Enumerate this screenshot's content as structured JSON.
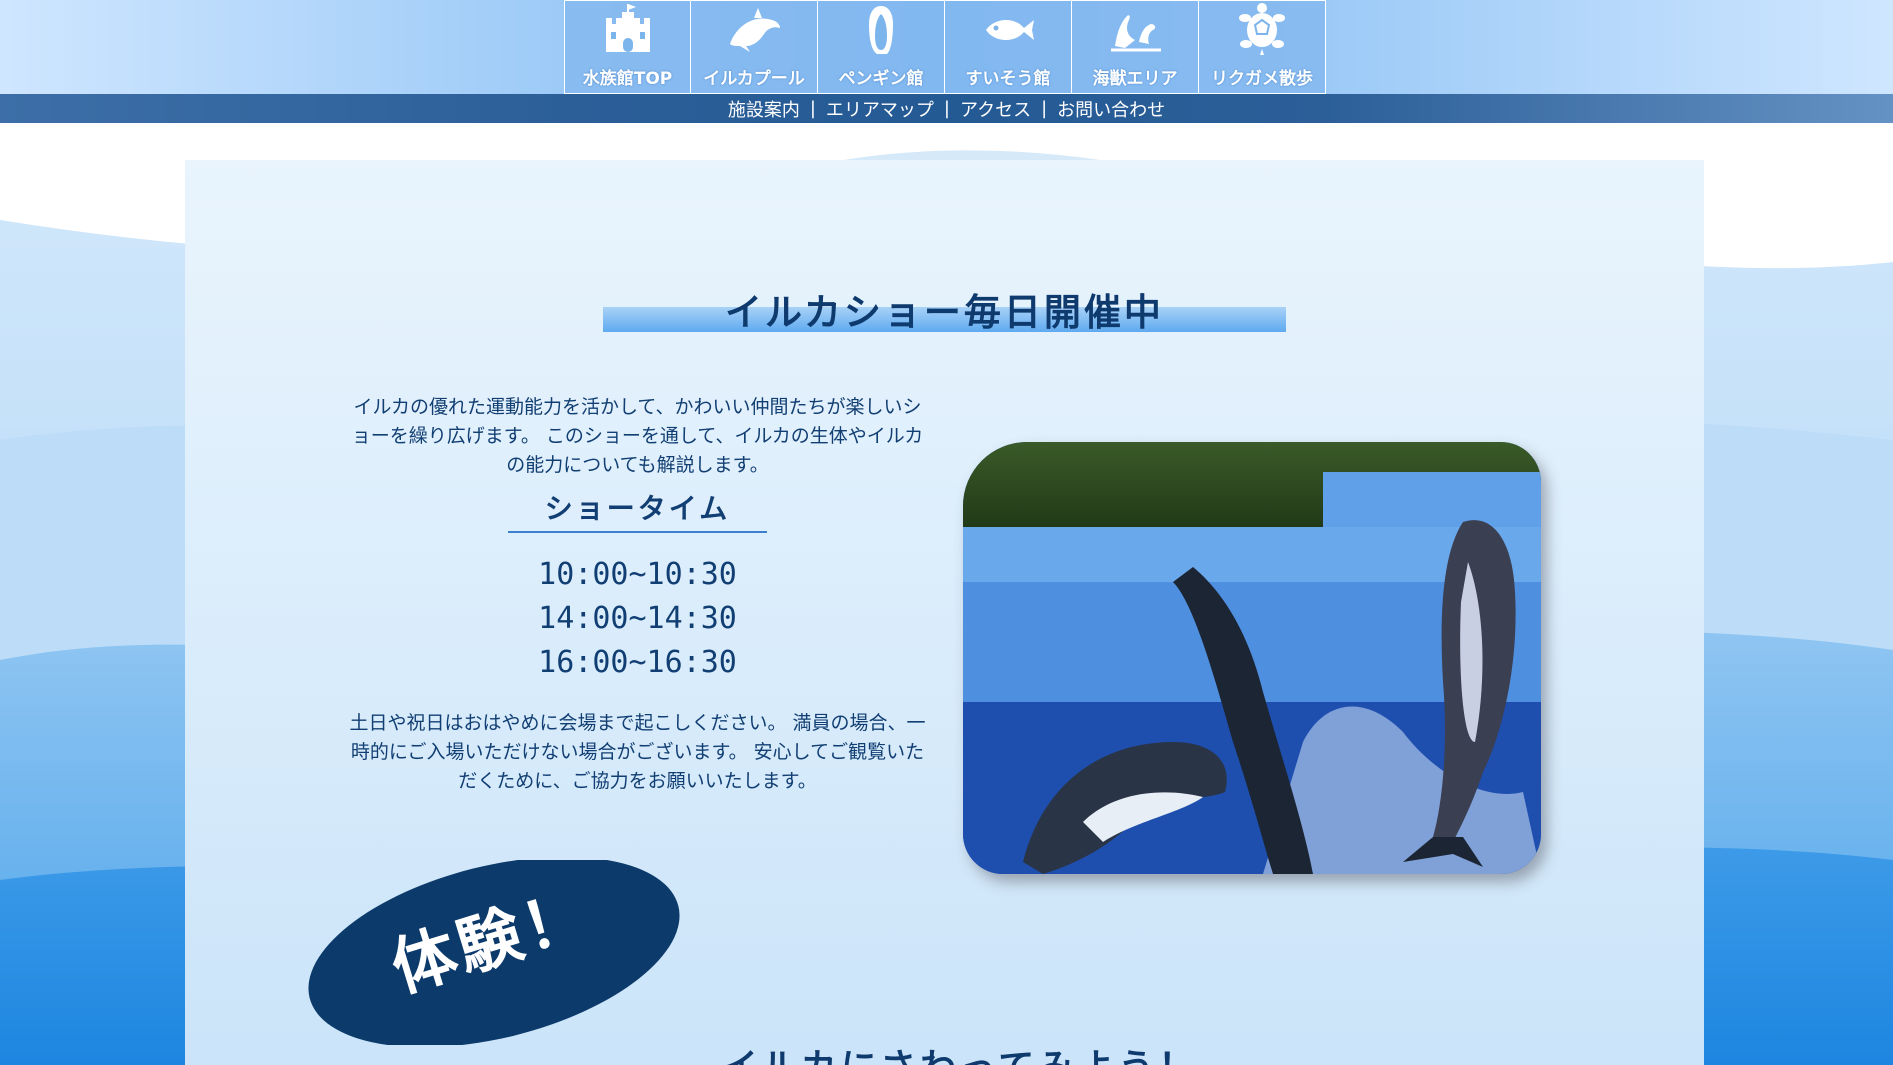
{
  "nav": {
    "tiles": [
      {
        "label": "水族館TOP",
        "icon": "castle-icon"
      },
      {
        "label": "イルカプール",
        "icon": "dolphin-icon"
      },
      {
        "label": "ペンギン館",
        "icon": "penguin-icon"
      },
      {
        "label": "すいそう館",
        "icon": "fish-icon"
      },
      {
        "label": "海獣エリア",
        "icon": "seal-icon"
      },
      {
        "label": "リクガメ散歩",
        "icon": "turtle-icon"
      }
    ],
    "sub_links": [
      "施設案内",
      "エリアマップ",
      "アクセス",
      "お問い合わせ"
    ],
    "separator": "|"
  },
  "main": {
    "section_title": "イルカショー毎日開催中",
    "intro": "イルカの優れた運動能力を活かして、かわいい仲間たちが楽しいショーを繰り広げます。 このショーを通して、イルカの生体やイルカの能力についても解説します。",
    "showtime_heading": "ショータイム",
    "showtimes": [
      "10:00~10:30",
      "14:00~14:30",
      "16:00~16:30"
    ],
    "notice": "土日や祝日はおはやめに会場まで起こしください。 満員の場合、一時的にご入場いただけない場合がございます。 安心してご観覧いただくために、ご協力をお願いいたします。",
    "photo": "dolphin-show-photo",
    "badge_text": "体験！",
    "bottom_heading": "イルカにさわってみよう！"
  },
  "colors": {
    "nav_tile": "#7cb4ec",
    "sub_bar": "#2c5f98",
    "title_bar": "#5eaaf0",
    "badge": "#0c3a6b",
    "text": "#123f73"
  }
}
